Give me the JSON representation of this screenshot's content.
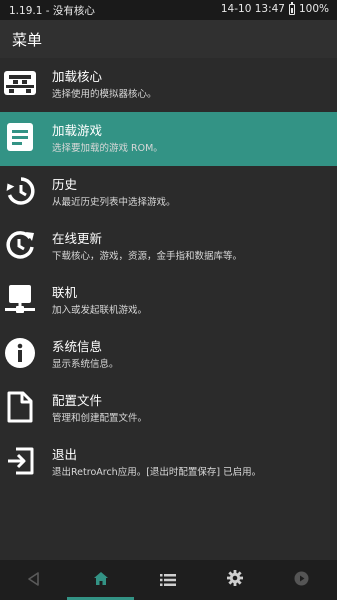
{
  "status": {
    "left": "1.19.1 - 没有核心",
    "right": "14-10 13:47",
    "battery": "100%"
  },
  "appbar": {
    "title": "菜单"
  },
  "colors": {
    "accent": "#339385",
    "background": "#2b2b2b"
  },
  "menu": [
    {
      "label": "加载核心",
      "sub": "选择使用的模拟器核心。",
      "icon": "retroarch-invader-icon",
      "selected": false
    },
    {
      "label": "加载游戏",
      "sub": "选择要加载的游戏 ROM。",
      "icon": "document-lines-icon",
      "selected": true
    },
    {
      "label": "历史",
      "sub": "从最近历史列表中选择游戏。",
      "icon": "history-icon",
      "selected": false
    },
    {
      "label": "在线更新",
      "sub": "下载核心，游戏，资源，金手指和数据库等。",
      "icon": "update-icon",
      "selected": false
    },
    {
      "label": "联机",
      "sub": "加入或发起联机游戏。",
      "icon": "network-icon",
      "selected": false
    },
    {
      "label": "系统信息",
      "sub": "显示系统信息。",
      "icon": "info-icon",
      "selected": false
    },
    {
      "label": "配置文件",
      "sub": "管理和创建配置文件。",
      "icon": "file-icon",
      "selected": false
    },
    {
      "label": "退出",
      "sub": "退出RetroArch应用。[退出时配置保存] 已启用。",
      "icon": "exit-icon",
      "selected": false
    }
  ],
  "bottom_nav": [
    "back-icon",
    "home-icon",
    "list-icon",
    "settings-icon",
    "playlist-icon"
  ]
}
